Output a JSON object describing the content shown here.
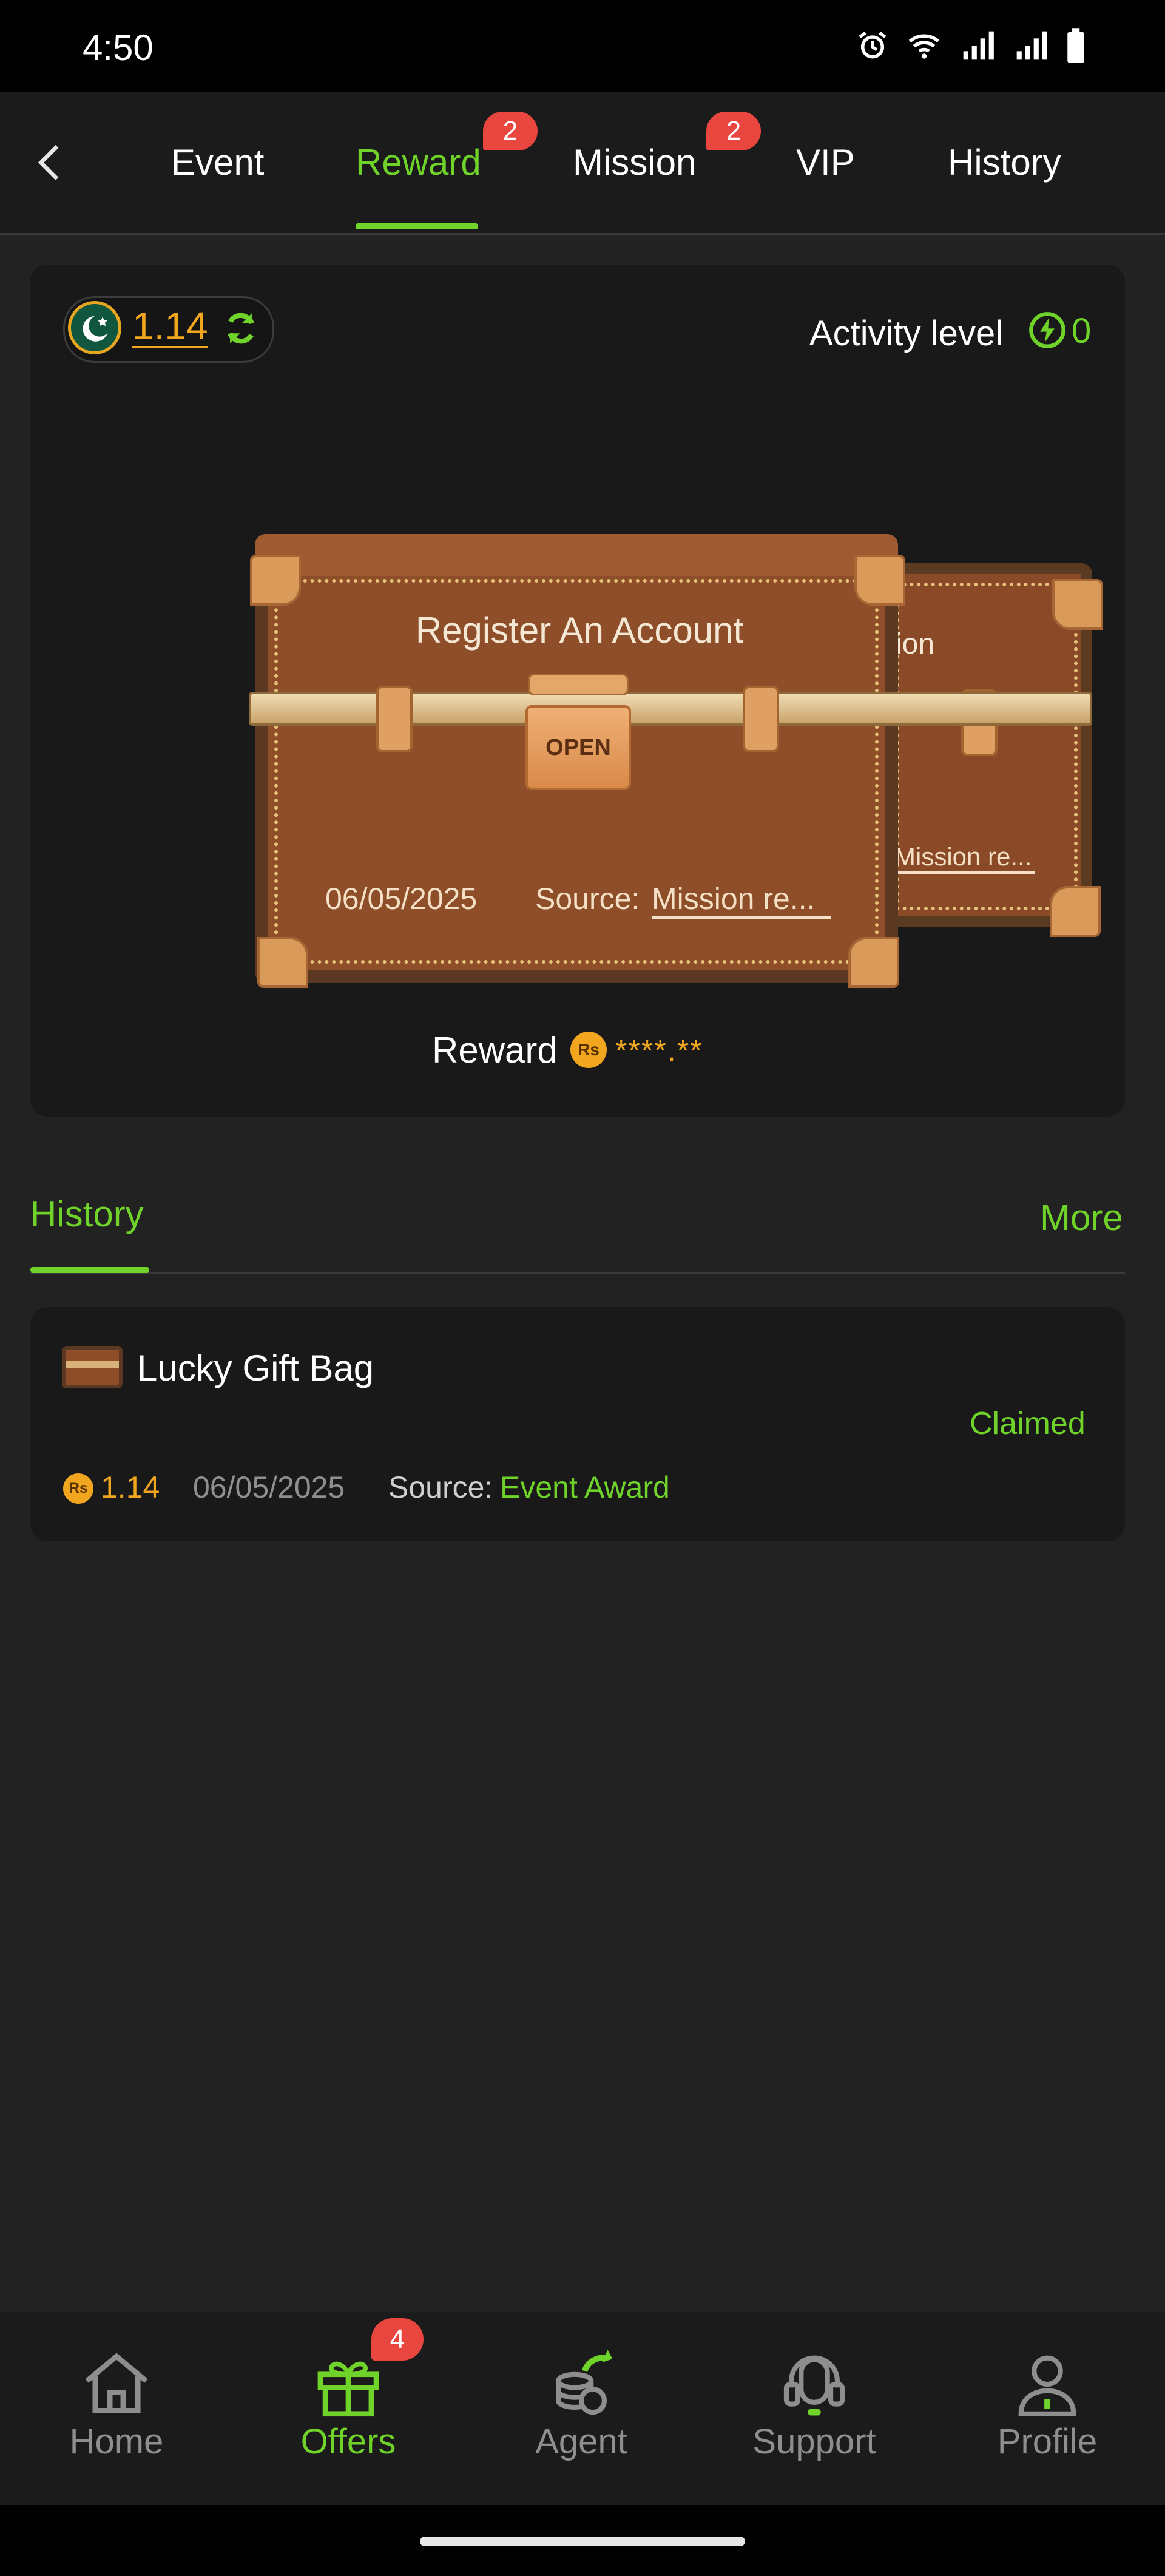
{
  "status_bar": {
    "time": "4:50"
  },
  "top_nav": {
    "tabs": [
      {
        "label": "Event",
        "active": false,
        "badge": null
      },
      {
        "label": "Reward",
        "active": true,
        "badge": "2"
      },
      {
        "label": "Mission",
        "active": false,
        "badge": "2"
      },
      {
        "label": "VIP",
        "active": false,
        "badge": null
      },
      {
        "label": "History",
        "active": false,
        "badge": null
      }
    ]
  },
  "reward_card": {
    "balance": "1.14",
    "activity_label": "Activity level",
    "activity_value": "0",
    "chest": {
      "open_label": "OPEN",
      "title": "Register An Account",
      "date": "06/05/2025",
      "source_label": "Source:",
      "source_value": "Mission re...",
      "back_title": "ion",
      "back_source": "Mission re..."
    },
    "reward_label": "Reward",
    "reward_coin": "Rs",
    "reward_masked": "****.**"
  },
  "history": {
    "tab_label": "History",
    "more_label": "More",
    "items": [
      {
        "title": "Lucky Gift Bag",
        "status": "Claimed",
        "coin": "Rs",
        "amount": "1.14",
        "date": "06/05/2025",
        "source_label": "Source:",
        "source_value": "Event Award"
      }
    ]
  },
  "bottom_nav": {
    "items": [
      {
        "label": "Home",
        "icon": "home-icon",
        "active": false
      },
      {
        "label": "Offers",
        "icon": "gift-icon",
        "active": true,
        "badge": "4"
      },
      {
        "label": "Agent",
        "icon": "agent-icon",
        "active": false
      },
      {
        "label": "Support",
        "icon": "headset-icon",
        "active": false
      },
      {
        "label": "Profile",
        "icon": "profile-icon",
        "active": false
      }
    ]
  },
  "colors": {
    "accent": "#6fd32a",
    "coin": "#f0a71f",
    "badge": "#e8463f",
    "background": "#222222",
    "card": "#191919"
  }
}
